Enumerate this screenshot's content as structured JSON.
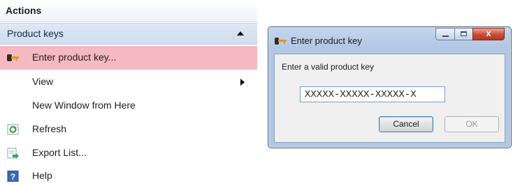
{
  "actions_pane": {
    "header": "Actions",
    "group": {
      "label": "Product keys"
    },
    "items": [
      {
        "label": "Enter product key...",
        "icon": "key-icon",
        "selected": true
      },
      {
        "label": "View",
        "icon": null,
        "submenu": true
      },
      {
        "label": "New Window from Here",
        "icon": null
      },
      {
        "label": "Refresh",
        "icon": "refresh-icon"
      },
      {
        "label": "Export List...",
        "icon": "export-list-icon"
      },
      {
        "label": "Help",
        "icon": "help-icon"
      }
    ]
  },
  "dialog": {
    "title": "Enter product key",
    "prompt": "Enter a valid product key",
    "key_value": "XXXXX-XXXXX-XXXXX-X",
    "cancel_label": "Cancel",
    "ok_label": "OK",
    "ok_enabled": false,
    "close_glyph": "x"
  },
  "colors": {
    "selected_item": "#f6b9c1",
    "group_header": "#cfdced",
    "dialog_frame": "#b2c7e4",
    "close_button": "#c94a34"
  }
}
